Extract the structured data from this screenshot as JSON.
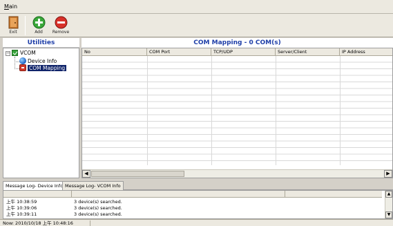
{
  "menu": {
    "main_label": "Main"
  },
  "toolbar": {
    "exit_label": "Exit",
    "add_label": "Add",
    "remove_label": "Remove"
  },
  "sidebar": {
    "title": "Utilities",
    "root_label": "VCOM",
    "items": [
      {
        "label": "Device Info",
        "icon": "globe-icon"
      },
      {
        "label": "COM Mapping",
        "icon": "com-mapping-icon",
        "selected": true
      }
    ]
  },
  "mapping": {
    "title": "COM Mapping - 0 COM(s)",
    "columns": [
      "No",
      "COM Port",
      "TCP/UDP",
      "Server/Client",
      "IP Address"
    ],
    "rows": []
  },
  "log_tabs": [
    "Message Log- Device Info",
    "Message Log- VCOM Info"
  ],
  "log": {
    "rows": [
      {
        "time": "上午 10:38:59",
        "message": "3 device(s) searched."
      },
      {
        "time": "上午 10:39:06",
        "message": "3 device(s) searched."
      },
      {
        "time": "上午 10:39:11",
        "message": "3 device(s) searched."
      }
    ]
  },
  "status": {
    "text": "Now: 2010/10/18 上午 10:48:16"
  },
  "colors": {
    "header_blue": "#1e3ea8",
    "selection": "#10246a",
    "add_green": "#3aa83a",
    "remove_red": "#d8312a",
    "exit_brown": "#c5762e"
  }
}
